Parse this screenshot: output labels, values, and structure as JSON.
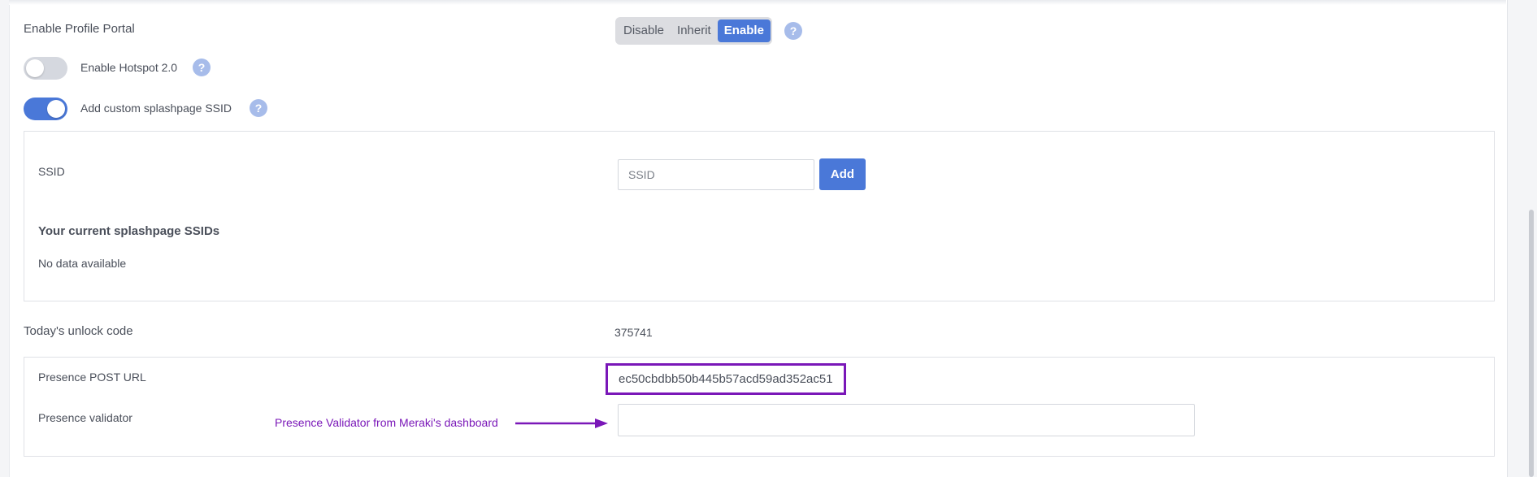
{
  "profile_portal": {
    "label": "Enable Profile Portal",
    "options": [
      "Disable",
      "Inherit",
      "Enable"
    ],
    "selected": "Enable",
    "help": "?"
  },
  "hotspot": {
    "label": "Enable Hotspot 2.0",
    "enabled": false,
    "help": "?"
  },
  "custom_splash": {
    "label": "Add custom splashpage SSID",
    "enabled": true,
    "help": "?",
    "ssid_label": "SSID",
    "ssid_placeholder": "SSID",
    "add_button": "Add",
    "current_title": "Your current splashpage SSIDs",
    "empty_text": "No data available"
  },
  "unlock": {
    "label": "Today's unlock code",
    "value": "375741"
  },
  "presence": {
    "post_url_label": "Presence POST URL",
    "post_url_value": "ec50cbdbb50b445b57acd59ad352ac51",
    "validator_label": "Presence validator",
    "validator_value": "",
    "annotation": "Presence Validator from Meraki's dashboard"
  },
  "colors": {
    "accent": "#4a78d8",
    "annotation": "#7a17b8",
    "help_icon": "#a7bcea"
  }
}
